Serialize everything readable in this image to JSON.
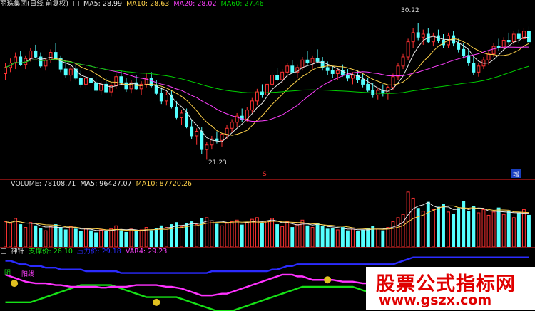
{
  "price_header": {
    "title": "丽珠集团(日线 前复权)",
    "ma5": "MA5: 28.99",
    "ma10": "MA10: 28.63",
    "ma20": "MA20: 28.02",
    "ma60": "MA60: 27.46"
  },
  "price_labels": {
    "high": "30.22",
    "low": "21.23"
  },
  "volume_header": {
    "volume": "VOLUME: 78108.71",
    "ma5": "MA5: 96427.07",
    "ma10": "MA10: 87720.26"
  },
  "indicator_header": {
    "name": "神针",
    "support": "支撑价: 26.10",
    "pressure": "压力价: 29.18",
    "var4": "VAR4: 29.23"
  },
  "indicator_tags": {
    "left_a": "阴",
    "left_b": "阳线"
  },
  "markers": {
    "s": "S",
    "zeng": "增"
  },
  "watermark": {
    "title": "股票公式指标网",
    "url": "www.gszx.com"
  },
  "colors": {
    "up": "#ff3232",
    "down": "#54ffff",
    "ma5": "#e8e8e8",
    "ma10": "#ffd24a",
    "ma20": "#ff40ff",
    "ma60": "#00d000",
    "blue": "#2b2bff",
    "green": "#16e016",
    "magenta": "#ff32ff",
    "brand": "#e00000"
  },
  "chart_data": {
    "type": "candlestick",
    "ylim": [
      20.5,
      31
    ],
    "candles": [
      [
        26.9,
        27.6,
        26.5,
        27.3
      ],
      [
        27.3,
        27.9,
        27.0,
        27.6
      ],
      [
        27.6,
        28.3,
        27.2,
        28.0
      ],
      [
        28.0,
        28.4,
        27.4,
        27.5
      ],
      [
        27.5,
        28.1,
        27.2,
        27.9
      ],
      [
        27.9,
        28.6,
        27.7,
        28.4
      ],
      [
        28.4,
        28.8,
        27.9,
        28.0
      ],
      [
        28.0,
        28.3,
        27.3,
        27.4
      ],
      [
        27.4,
        27.9,
        27.1,
        27.8
      ],
      [
        27.8,
        28.5,
        27.6,
        28.3
      ],
      [
        28.3,
        28.9,
        27.8,
        27.9
      ],
      [
        27.9,
        28.1,
        27.0,
        27.2
      ],
      [
        27.2,
        27.7,
        26.6,
        26.8
      ],
      [
        26.8,
        27.4,
        26.4,
        27.2
      ],
      [
        27.2,
        27.6,
        26.5,
        26.6
      ],
      [
        26.6,
        27.1,
        26.0,
        26.2
      ],
      [
        26.2,
        26.8,
        25.9,
        26.6
      ],
      [
        26.6,
        27.0,
        26.1,
        26.3
      ],
      [
        26.3,
        26.7,
        25.7,
        25.8
      ],
      [
        25.8,
        26.4,
        25.5,
        26.2
      ],
      [
        26.2,
        26.6,
        25.6,
        25.7
      ],
      [
        25.7,
        26.3,
        25.4,
        26.1
      ],
      [
        26.1,
        26.9,
        25.9,
        26.7
      ],
      [
        26.7,
        27.1,
        26.2,
        26.3
      ],
      [
        26.3,
        26.6,
        25.7,
        25.9
      ],
      [
        25.9,
        26.5,
        25.6,
        26.3
      ],
      [
        26.3,
        26.8,
        25.8,
        25.9
      ],
      [
        25.9,
        26.4,
        25.5,
        26.2
      ],
      [
        26.2,
        26.9,
        26.0,
        26.6
      ],
      [
        26.6,
        27.0,
        26.0,
        26.1
      ],
      [
        26.1,
        26.5,
        25.5,
        25.6
      ],
      [
        25.6,
        26.0,
        24.9,
        25.1
      ],
      [
        25.1,
        25.7,
        24.8,
        25.5
      ],
      [
        25.5,
        25.8,
        24.6,
        24.7
      ],
      [
        24.7,
        25.1,
        23.9,
        24.0
      ],
      [
        24.0,
        24.5,
        23.5,
        24.3
      ],
      [
        24.3,
        24.6,
        23.3,
        23.4
      ],
      [
        23.4,
        23.9,
        22.6,
        22.8
      ],
      [
        22.8,
        23.3,
        22.2,
        23.1
      ],
      [
        23.1,
        23.4,
        21.6,
        21.9
      ],
      [
        21.9,
        22.4,
        21.23,
        22.2
      ],
      [
        22.2,
        22.8,
        21.9,
        22.6
      ],
      [
        22.6,
        23.1,
        22.3,
        22.5
      ],
      [
        22.5,
        23.0,
        22.1,
        22.9
      ],
      [
        22.9,
        23.5,
        22.6,
        23.3
      ],
      [
        23.3,
        23.9,
        23.0,
        23.7
      ],
      [
        23.7,
        24.3,
        23.4,
        24.1
      ],
      [
        24.1,
        24.6,
        23.7,
        23.9
      ],
      [
        23.9,
        24.7,
        23.7,
        24.5
      ],
      [
        24.5,
        25.3,
        24.3,
        25.1
      ],
      [
        25.1,
        25.9,
        24.8,
        25.7
      ],
      [
        25.7,
        26.2,
        25.3,
        25.5
      ],
      [
        25.5,
        26.4,
        25.3,
        26.2
      ],
      [
        26.2,
        27.0,
        26.0,
        26.8
      ],
      [
        26.8,
        27.3,
        26.4,
        26.5
      ],
      [
        26.5,
        27.2,
        26.3,
        27.0
      ],
      [
        27.0,
        27.6,
        26.7,
        27.4
      ],
      [
        27.4,
        27.8,
        26.9,
        27.0
      ],
      [
        27.0,
        27.5,
        26.6,
        27.3
      ],
      [
        27.3,
        28.0,
        27.1,
        27.8
      ],
      [
        27.8,
        28.4,
        27.5,
        27.6
      ],
      [
        27.6,
        28.1,
        27.2,
        27.9
      ],
      [
        27.9,
        28.5,
        27.6,
        27.7
      ],
      [
        27.7,
        28.0,
        27.1,
        27.3
      ],
      [
        27.3,
        27.7,
        26.8,
        27.1
      ],
      [
        27.1,
        27.4,
        26.6,
        26.9
      ],
      [
        26.9,
        27.3,
        26.5,
        27.1
      ],
      [
        27.1,
        27.5,
        26.7,
        26.8
      ],
      [
        26.8,
        27.2,
        26.4,
        26.6
      ],
      [
        26.6,
        27.0,
        26.2,
        26.8
      ],
      [
        26.8,
        27.1,
        26.3,
        26.5
      ],
      [
        26.5,
        26.9,
        26.0,
        26.2
      ],
      [
        26.2,
        26.6,
        25.7,
        25.8
      ],
      [
        25.8,
        26.3,
        25.3,
        25.5
      ],
      [
        25.5,
        26.0,
        25.2,
        25.8
      ],
      [
        25.8,
        26.2,
        25.4,
        25.6
      ],
      [
        25.6,
        26.1,
        25.2,
        26.0
      ],
      [
        26.0,
        26.9,
        25.8,
        26.7
      ],
      [
        26.7,
        27.6,
        26.5,
        27.4
      ],
      [
        27.4,
        28.2,
        27.2,
        28.0
      ],
      [
        28.0,
        29.2,
        27.8,
        29.0
      ],
      [
        29.0,
        29.9,
        28.6,
        29.6
      ],
      [
        29.6,
        30.22,
        29.1,
        29.3
      ],
      [
        29.3,
        29.8,
        28.8,
        29.5
      ],
      [
        29.5,
        29.9,
        28.9,
        29.0
      ],
      [
        29.0,
        29.6,
        28.7,
        29.4
      ],
      [
        29.4,
        29.8,
        28.9,
        29.1
      ],
      [
        29.1,
        29.5,
        28.6,
        28.8
      ],
      [
        28.8,
        29.6,
        28.6,
        29.4
      ],
      [
        29.4,
        29.7,
        28.7,
        28.9
      ],
      [
        28.9,
        29.2,
        28.3,
        28.5
      ],
      [
        28.5,
        28.9,
        27.9,
        28.1
      ],
      [
        28.1,
        28.5,
        27.4,
        27.6
      ],
      [
        27.6,
        28.0,
        26.8,
        27.0
      ],
      [
        27.0,
        27.6,
        26.7,
        27.4
      ],
      [
        27.4,
        28.0,
        27.2,
        27.8
      ],
      [
        27.8,
        28.4,
        27.5,
        28.2
      ],
      [
        28.2,
        28.9,
        28.0,
        28.7
      ],
      [
        28.7,
        29.2,
        28.4,
        28.6
      ],
      [
        28.6,
        29.3,
        28.5,
        29.1
      ],
      [
        29.1,
        29.6,
        28.8,
        29.0
      ],
      [
        29.0,
        29.7,
        28.8,
        29.5
      ],
      [
        29.5,
        29.8,
        28.9,
        29.2
      ],
      [
        29.2,
        29.9,
        29.0,
        29.7
      ],
      [
        29.7,
        30.0,
        28.9,
        29.0
      ]
    ],
    "volume": [
      62,
      58,
      70,
      55,
      48,
      60,
      52,
      45,
      40,
      50,
      55,
      48,
      42,
      50,
      44,
      38,
      46,
      40,
      35,
      42,
      38,
      45,
      52,
      40,
      36,
      44,
      38,
      42,
      48,
      40,
      46,
      52,
      48,
      55,
      60,
      50,
      58,
      62,
      55,
      70,
      72,
      64,
      56,
      52,
      58,
      62,
      66,
      54,
      60,
      68,
      72,
      58,
      64,
      70,
      55,
      50,
      62,
      48,
      55,
      66,
      52,
      48,
      58,
      50,
      44,
      46,
      42,
      48,
      40,
      44,
      38,
      42,
      46,
      50,
      44,
      40,
      48,
      62,
      72,
      80,
      135,
      120,
      95,
      88,
      110,
      92,
      98,
      105,
      86,
      80,
      95,
      112,
      88,
      100,
      84,
      92,
      78,
      86,
      96,
      80,
      88,
      72,
      84,
      92,
      78
    ],
    "indicator": {
      "blue": [
        88,
        88,
        86,
        84,
        84,
        82,
        82,
        82,
        80,
        80,
        80,
        78,
        78,
        78,
        78,
        78,
        76,
        76,
        76,
        76,
        76,
        76,
        76,
        74,
        74,
        74,
        74,
        74,
        74,
        74,
        74,
        74,
        74,
        74,
        74,
        74,
        74,
        74,
        74,
        74,
        74,
        76,
        76,
        76,
        76,
        76,
        76,
        76,
        76,
        76,
        76,
        76,
        76,
        78,
        78,
        80,
        82,
        82,
        84,
        84,
        84,
        84,
        84,
        84,
        84,
        84,
        84,
        84,
        84,
        84,
        84,
        84,
        84,
        84,
        84,
        84,
        84,
        84,
        86,
        88,
        90,
        92,
        92,
        92,
        92,
        92,
        92,
        92,
        92,
        92,
        92,
        92,
        92,
        92,
        92,
        92,
        92,
        92,
        92,
        92,
        92,
        92,
        92,
        92,
        92
      ],
      "green": [
        40,
        40,
        40,
        40,
        40,
        40,
        42,
        44,
        46,
        48,
        50,
        52,
        54,
        56,
        58,
        60,
        60,
        60,
        60,
        60,
        60,
        60,
        58,
        56,
        54,
        52,
        50,
        48,
        46,
        46,
        46,
        46,
        46,
        46,
        46,
        44,
        42,
        40,
        38,
        36,
        34,
        32,
        30,
        30,
        30,
        30,
        32,
        34,
        36,
        38,
        40,
        42,
        44,
        46,
        48,
        50,
        52,
        54,
        56,
        58,
        58,
        58,
        58,
        58,
        58,
        58,
        58,
        58,
        58,
        58,
        56,
        54,
        52,
        50,
        50,
        52,
        54,
        56,
        58,
        60,
        62,
        62,
        62,
        62,
        62,
        62,
        62,
        62,
        62,
        62,
        62,
        62,
        62,
        62,
        62,
        62,
        62,
        62,
        62,
        62,
        62,
        62,
        62,
        62,
        62
      ],
      "magenta": [
        72,
        70,
        68,
        66,
        64,
        63,
        62,
        62,
        62,
        61,
        60,
        60,
        59,
        58,
        58,
        58,
        58,
        58,
        58,
        57,
        57,
        58,
        58,
        58,
        58,
        59,
        60,
        60,
        60,
        60,
        60,
        59,
        58,
        58,
        57,
        56,
        54,
        52,
        50,
        48,
        48,
        48,
        49,
        50,
        50,
        52,
        54,
        56,
        58,
        60,
        62,
        64,
        66,
        68,
        70,
        72,
        72,
        72,
        70,
        70,
        68,
        66,
        66,
        66,
        66,
        66,
        65,
        64,
        64,
        64,
        63,
        62,
        62,
        63,
        64,
        65,
        66,
        68,
        70,
        72,
        74,
        74,
        73,
        72,
        72,
        72,
        72,
        72,
        72,
        72,
        72,
        72,
        72,
        72,
        72,
        72,
        72,
        72,
        72,
        72,
        72,
        72,
        72,
        72,
        72
      ],
      "ylim": [
        30,
        95
      ]
    }
  }
}
